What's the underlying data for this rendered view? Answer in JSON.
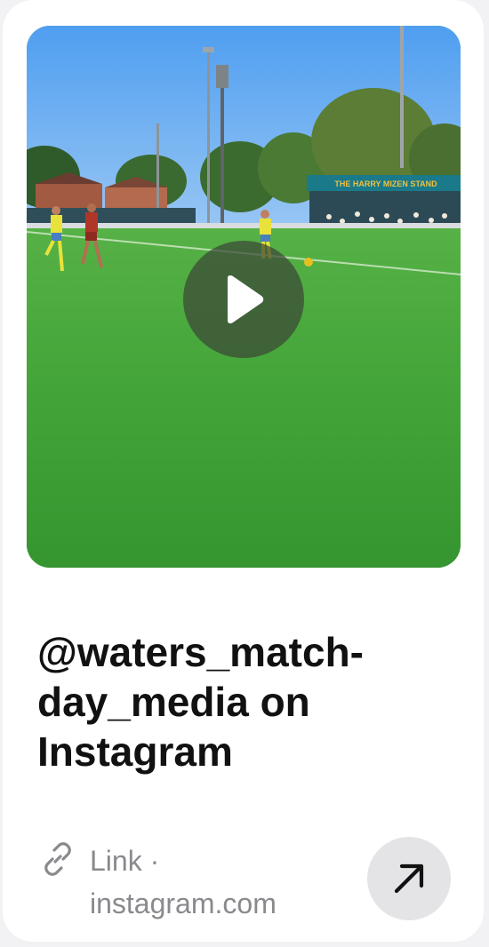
{
  "card": {
    "title": "@waters_match-day_media on Instagram",
    "type_label": "Link",
    "separator": "·",
    "domain": "instagram.com"
  },
  "media": {
    "stand_sign": "THE HARRY MIZEN STAND"
  },
  "icons": {
    "play": "play-icon",
    "link": "link-icon",
    "open": "arrow-up-right-icon"
  },
  "colors": {
    "title": "#111111",
    "meta": "#8a8a8e",
    "open_button_bg": "#e4e4e7",
    "pitch_green": "#3fa23a",
    "sky_blue": "#5aa6f0"
  }
}
